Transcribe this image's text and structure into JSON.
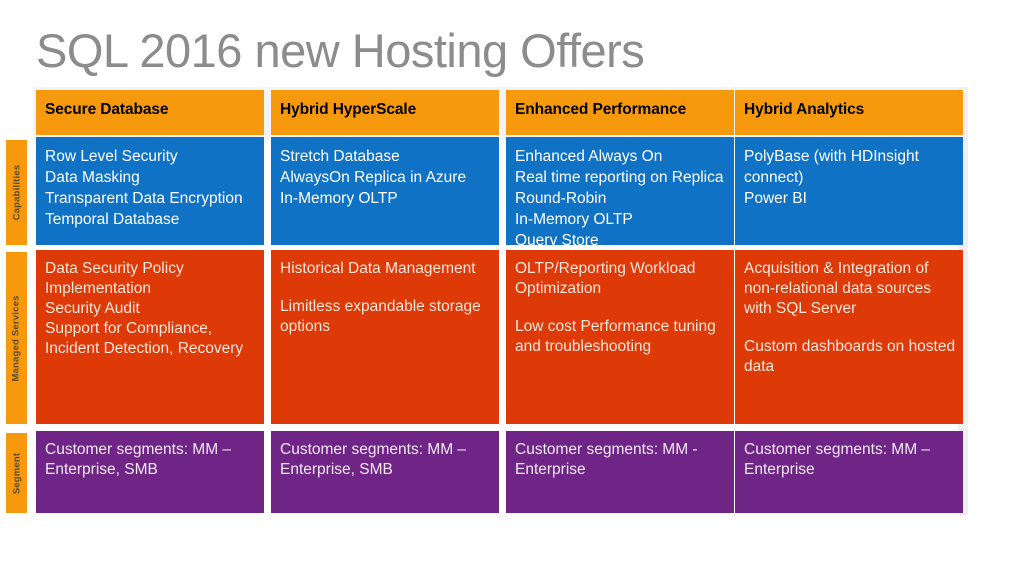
{
  "slide": {
    "title": "SQL 2016 new Hosting Offers",
    "colors": {
      "header_orange": "#F7990C",
      "capabilities_blue": "#0F72C4",
      "managed_red": "#DD3A07",
      "segment_purple": "#6E2585",
      "title_gray": "#8C8C8C"
    }
  },
  "row_labels": {
    "capabilities": "Capabilities",
    "managed_services": "Managed Services",
    "segment": "Segment"
  },
  "columns": [
    {
      "header": "Secure Database",
      "capabilities": [
        "Row Level Security",
        "Data Masking",
        "Transparent Data Encryption",
        "Temporal Database"
      ],
      "managed_services": [
        "Data Security Policy Implementation",
        "Security Audit",
        "Support for Compliance, Incident Detection, Recovery"
      ],
      "managed_services_gap_index": -1,
      "segment": "Customer segments: MM – Enterprise, SMB"
    },
    {
      "header": "Hybrid HyperScale",
      "capabilities": [
        "Stretch Database",
        "AlwaysOn Replica in Azure",
        "In-Memory OLTP"
      ],
      "managed_services": [
        "Historical Data Management",
        "Limitless expandable storage options"
      ],
      "managed_services_gap_index": 1,
      "segment": "Customer segments: MM – Enterprise, SMB"
    },
    {
      "header": "Enhanced Performance",
      "capabilities": [
        "Enhanced Always On",
        "Real time reporting on Replica Round-Robin",
        "In-Memory OLTP",
        "Query Store"
      ],
      "managed_services": [
        "OLTP/Reporting Workload Optimization",
        "Low cost Performance tuning and troubleshooting"
      ],
      "managed_services_gap_index": 1,
      "segment": "Customer segments: MM - Enterprise"
    },
    {
      "header": "Hybrid Analytics",
      "capabilities": [
        "PolyBase (with HDInsight connect)",
        "Power BI"
      ],
      "managed_services": [
        "Acquisition & Integration of non-relational data sources with SQL Server",
        "Custom dashboards on hosted data"
      ],
      "managed_services_gap_index": 1,
      "segment": "Customer segments: MM – Enterprise"
    }
  ]
}
